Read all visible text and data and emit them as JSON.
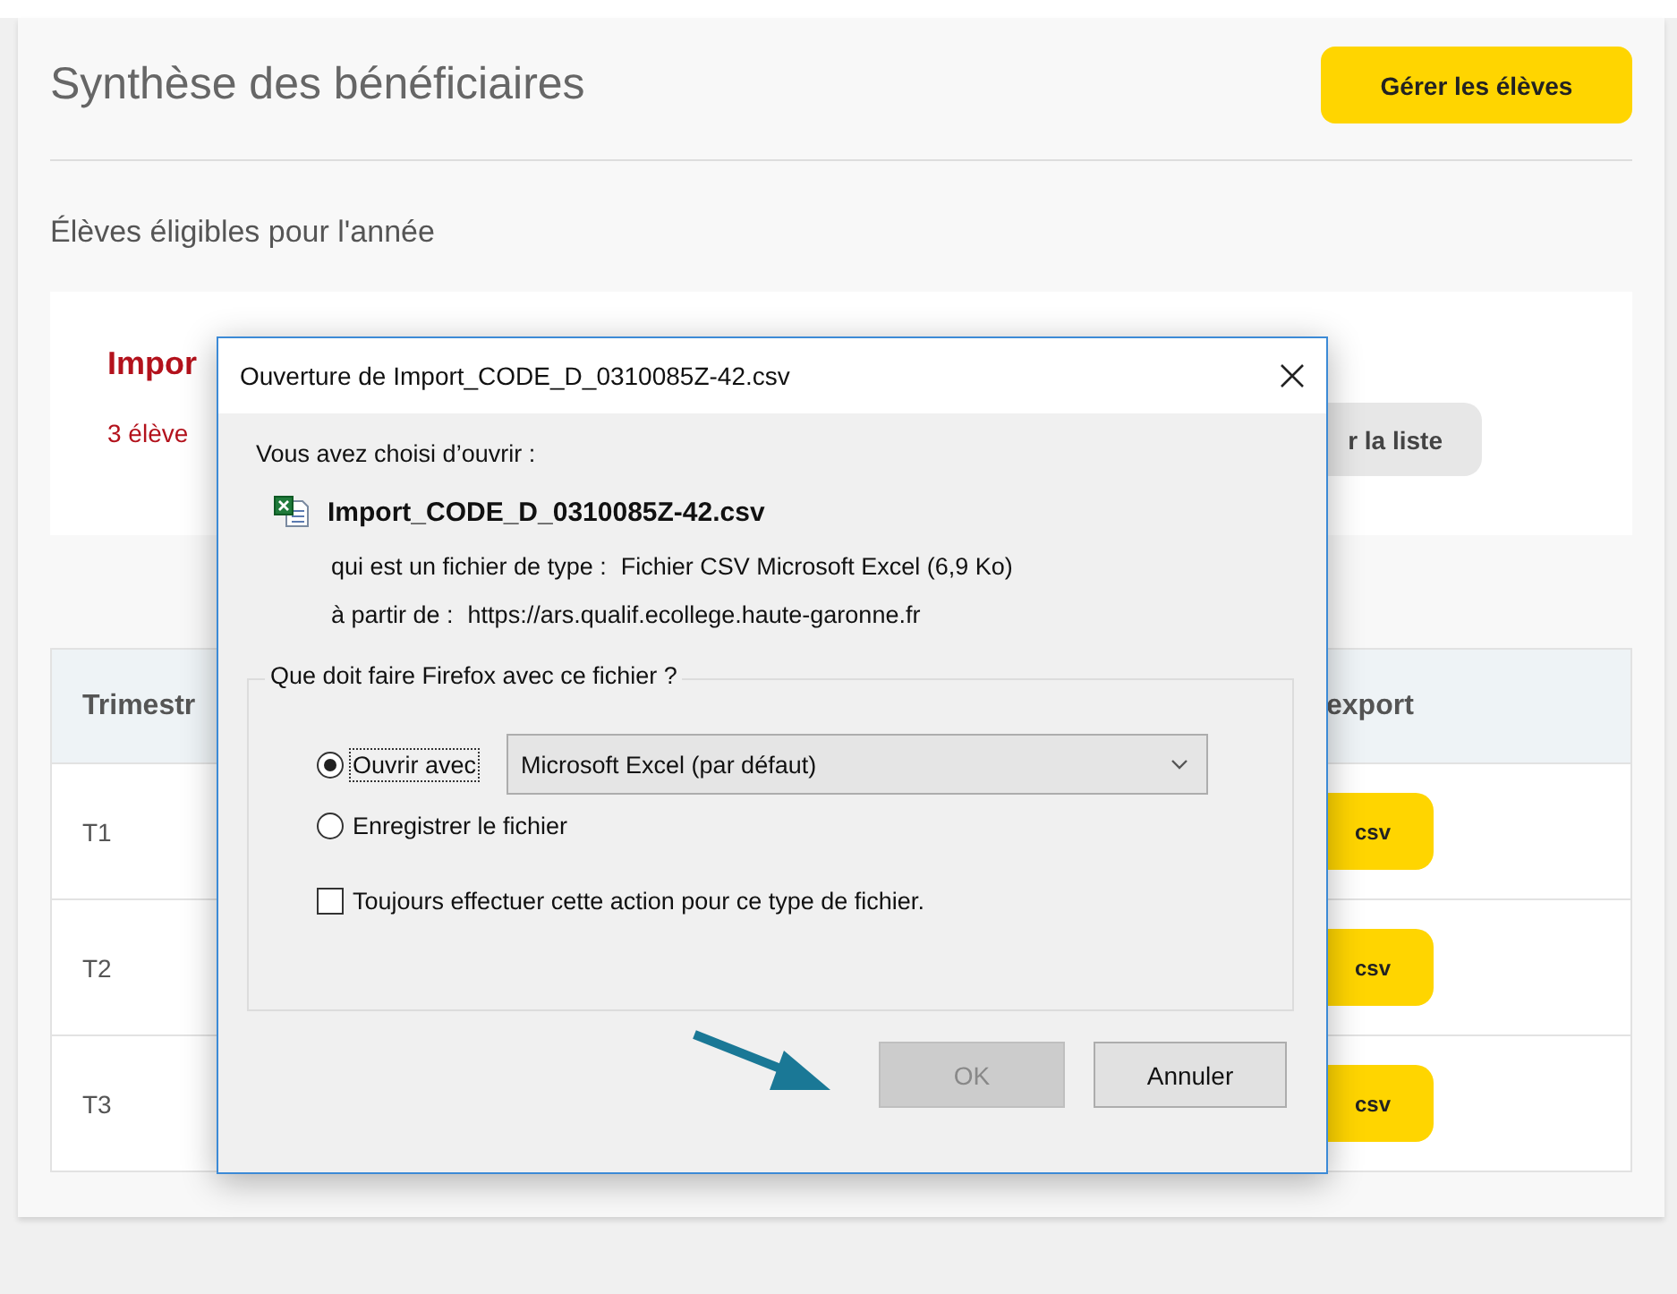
{
  "page": {
    "title": "Synthèse des bénéficiaires",
    "manage_button": "Gérer les élèves",
    "subtitle": "Élèves éligibles pour l'année"
  },
  "card": {
    "title": "Impor",
    "text": "3 élève",
    "button": "r la liste"
  },
  "table": {
    "header": {
      "column_1": "Trimestr",
      "column_4": "export"
    },
    "rows": [
      {
        "column_1": "T1",
        "column_4": "csv"
      },
      {
        "column_1": "T2",
        "column_4": "csv"
      },
      {
        "column_1": "T3",
        "column_4": "csv"
      }
    ]
  },
  "dialog": {
    "title": "Ouverture de Import_CODE_D_0310085Z-42.csv",
    "intro": "Vous avez choisi d’ouvrir :",
    "filename": "Import_CODE_D_0310085Z-42.csv",
    "type_label": "qui est un fichier de type :",
    "type_value": "Fichier CSV Microsoft Excel (6,9 Ko)",
    "from_label": "à partir de :",
    "from_value": "https://ars.qualif.ecollege.haute-garonne.fr",
    "group_label": "Que doit faire Firefox avec ce fichier ?",
    "options": [
      {
        "kind": "radio",
        "label": "Ouvrir avec",
        "selected": true,
        "dropdown": "Microsoft Excel (par défaut)"
      },
      {
        "kind": "radio",
        "label": "Enregistrer le fichier",
        "selected": false
      },
      {
        "kind": "checkbox",
        "label": "Toujours effectuer cette action pour ce type de fichier.",
        "checked": false
      }
    ],
    "buttons": [
      {
        "label": "OK",
        "disabled": true
      },
      {
        "label": "Annuler",
        "disabled": false
      }
    ]
  }
}
